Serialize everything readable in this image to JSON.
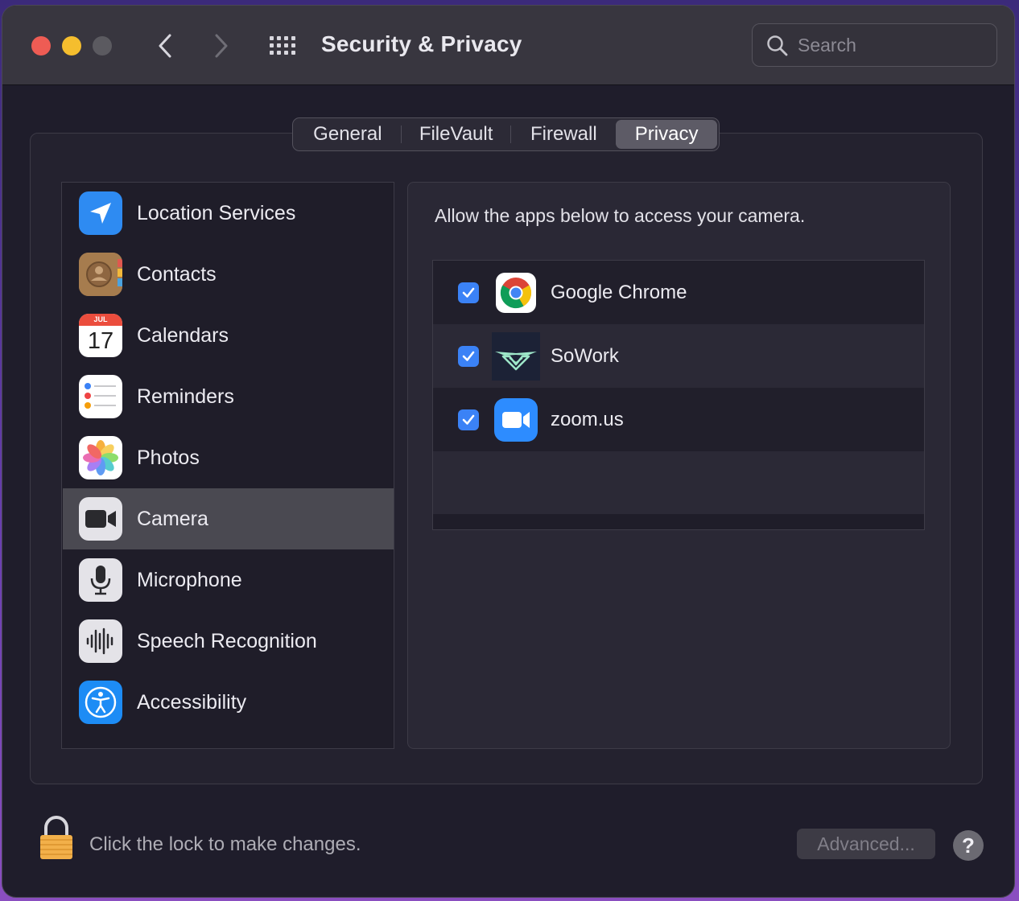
{
  "window": {
    "title": "Security & Privacy",
    "search_placeholder": "Search"
  },
  "tabs": [
    {
      "label": "General",
      "selected": false
    },
    {
      "label": "FileVault",
      "selected": false
    },
    {
      "label": "Firewall",
      "selected": false
    },
    {
      "label": "Privacy",
      "selected": true
    }
  ],
  "sidebar": {
    "items": [
      {
        "label": "Location Services",
        "icon": "location-arrow-icon"
      },
      {
        "label": "Contacts",
        "icon": "contacts-icon"
      },
      {
        "label": "Calendars",
        "icon": "calendar-icon",
        "icon_month": "JUL",
        "icon_day": "17"
      },
      {
        "label": "Reminders",
        "icon": "reminders-icon"
      },
      {
        "label": "Photos",
        "icon": "photos-icon"
      },
      {
        "label": "Camera",
        "icon": "camera-icon",
        "selected": true
      },
      {
        "label": "Microphone",
        "icon": "microphone-icon"
      },
      {
        "label": "Speech Recognition",
        "icon": "waveform-icon"
      },
      {
        "label": "Accessibility",
        "icon": "accessibility-icon"
      }
    ]
  },
  "pane": {
    "description": "Allow the apps below to access your camera.",
    "apps": [
      {
        "name": "Google Chrome",
        "checked": true,
        "icon": "chrome-icon"
      },
      {
        "name": "SoWork",
        "checked": true,
        "icon": "sowork-icon"
      },
      {
        "name": "zoom.us",
        "checked": true,
        "icon": "zoom-icon"
      }
    ]
  },
  "footer": {
    "lock_text": "Click the lock to make changes.",
    "advanced_label": "Advanced...",
    "help_label": "?"
  },
  "colors": {
    "accent": "#3b82f6",
    "selected_row": "#4a4951",
    "window_bg": "#1f1d2b"
  }
}
